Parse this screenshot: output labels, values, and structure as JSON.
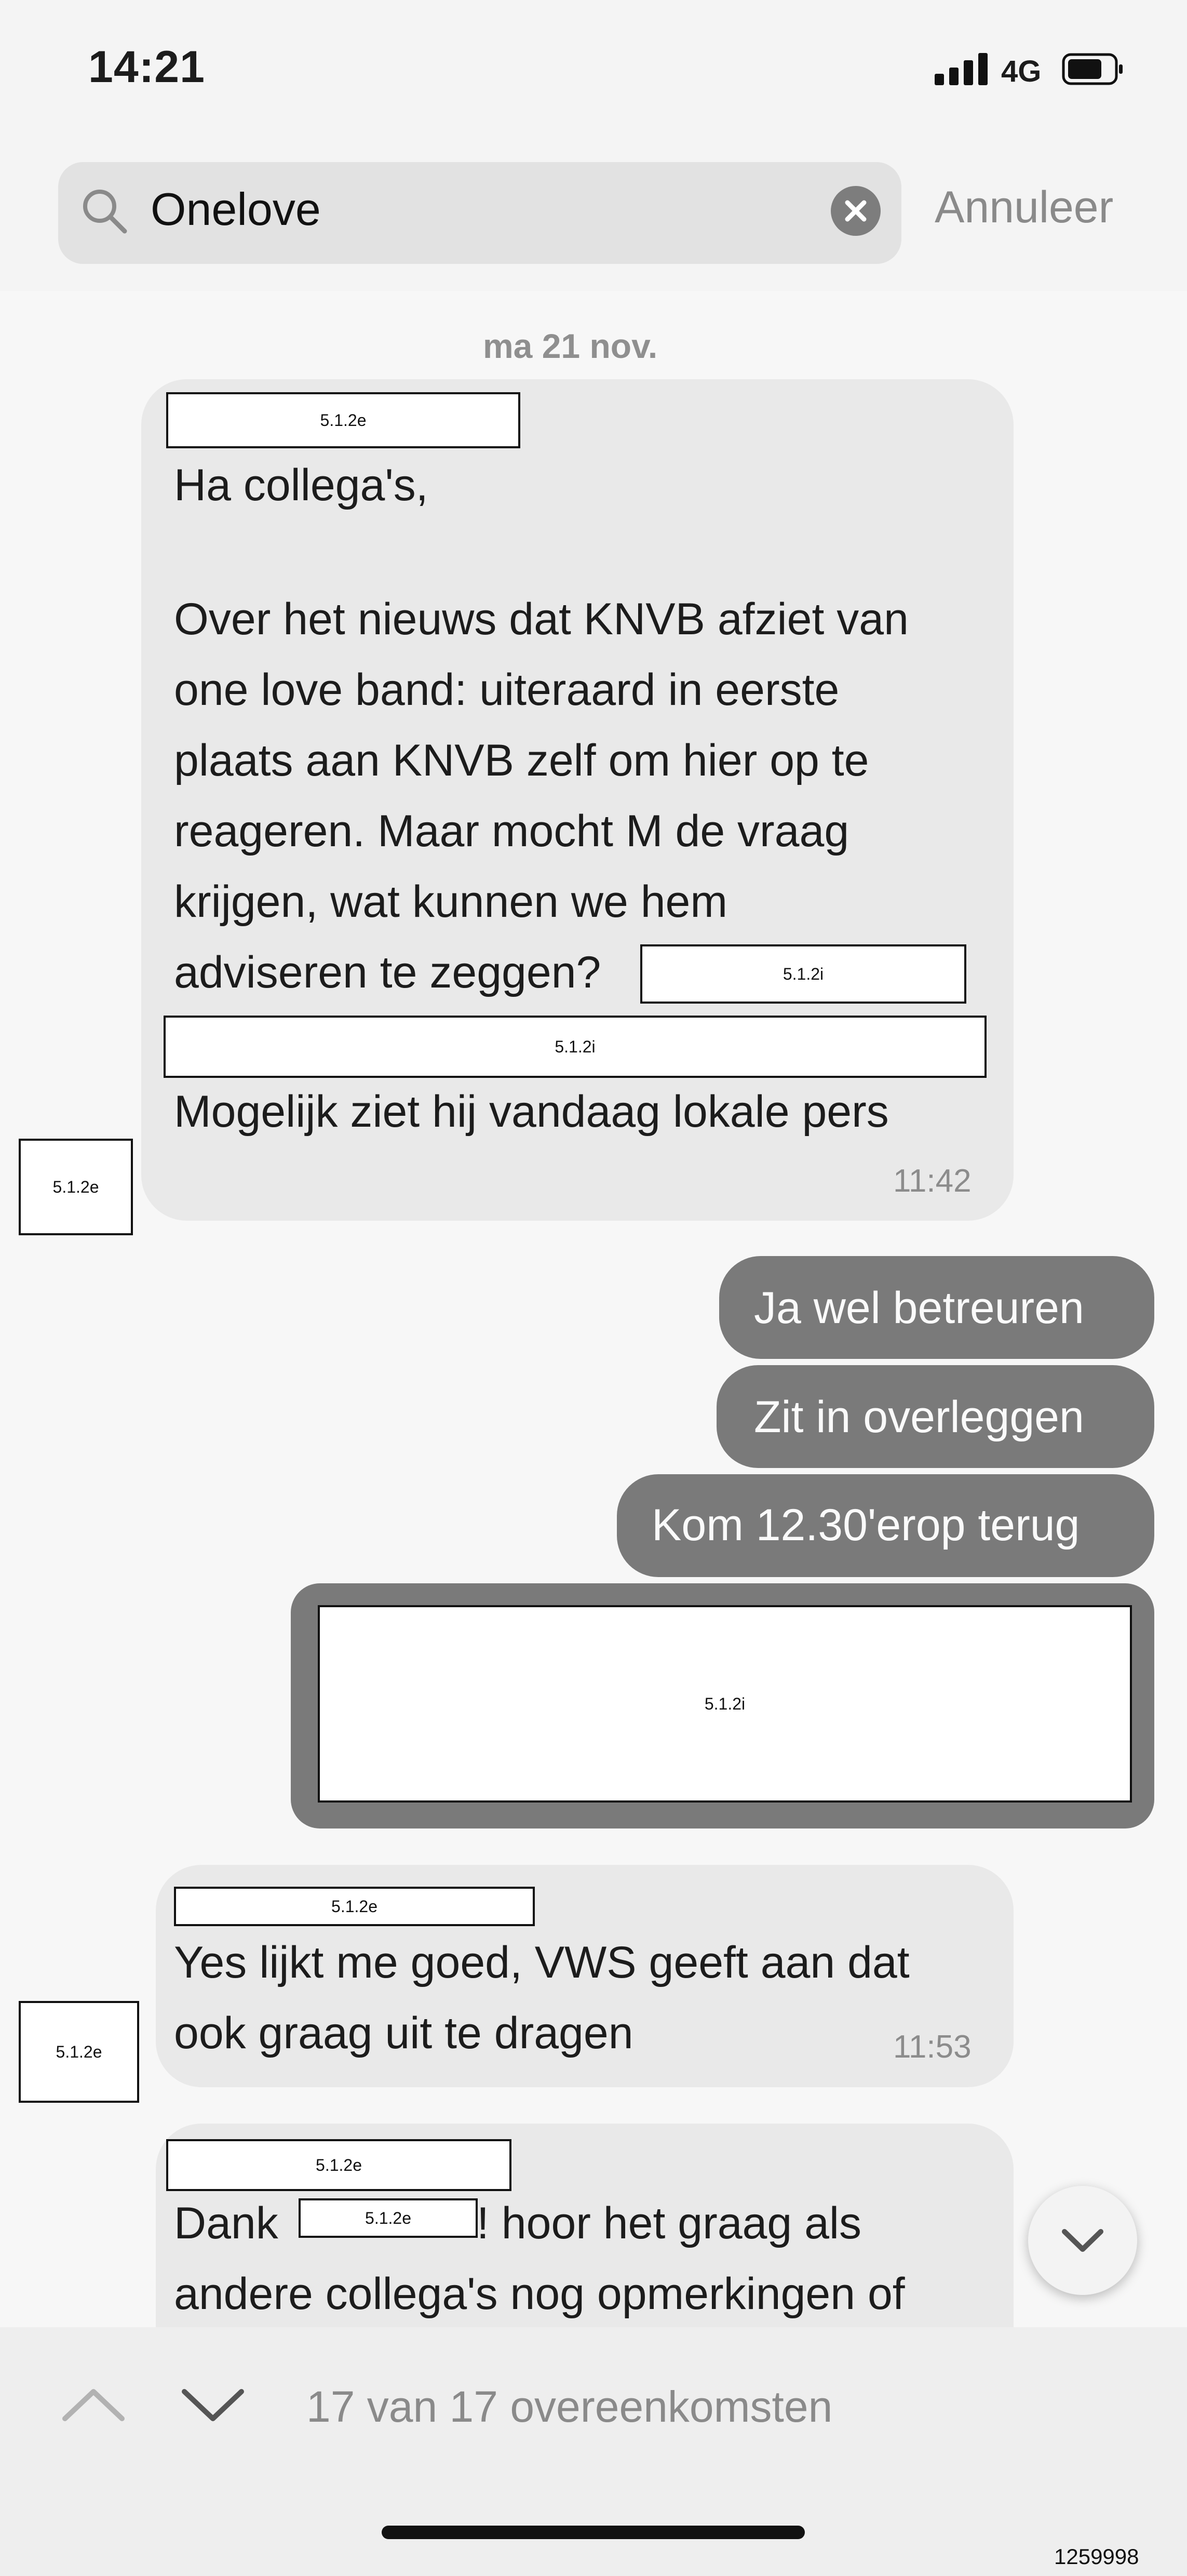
{
  "status_bar": {
    "time": "14:21",
    "network": "4G"
  },
  "search": {
    "query": "Onelove",
    "cancel_label": "Annuleer"
  },
  "chat": {
    "date_label": "ma 21 nov.",
    "message1": {
      "sender_code": "5.1.2e",
      "line1": "Ha collega's,",
      "para2": [
        "Over het nieuws dat KNVB afziet van",
        "one love band: uiteraard in eerste",
        "plaats aan KNVB zelf om hier op te",
        "reageren. Maar mocht M de vraag",
        "krijgen, wat kunnen we hem",
        "adviseren te zeggen?"
      ],
      "inline_code": "5.1.2i",
      "full_code": "5.1.2i",
      "last_line": "Mogelijk ziet hij vandaag lokale pers",
      "time": "11:42",
      "avatar_code": "5.1.2e"
    },
    "outgoing": [
      "Ja wel betreuren",
      "Zit in overleggen",
      "Kom 12.30'erop terug"
    ],
    "outgoing_redacted_code": "5.1.2i",
    "message2": {
      "sender_code": "5.1.2e",
      "lines": [
        "Yes lijkt me goed, VWS geeft aan dat",
        "ook graag uit te dragen"
      ],
      "time": "11:53",
      "avatar_code": "5.1.2e"
    },
    "message3": {
      "sender_code": "5.1.2e",
      "dank": "Dank",
      "name_code": "5.1.2e",
      "line1_rest": "! hoor het graag als",
      "line2": "andere collega's nog opmerkingen of"
    }
  },
  "footer": {
    "match_count": "17 van 17 overeenkomsten",
    "doc_number": "1259998"
  }
}
